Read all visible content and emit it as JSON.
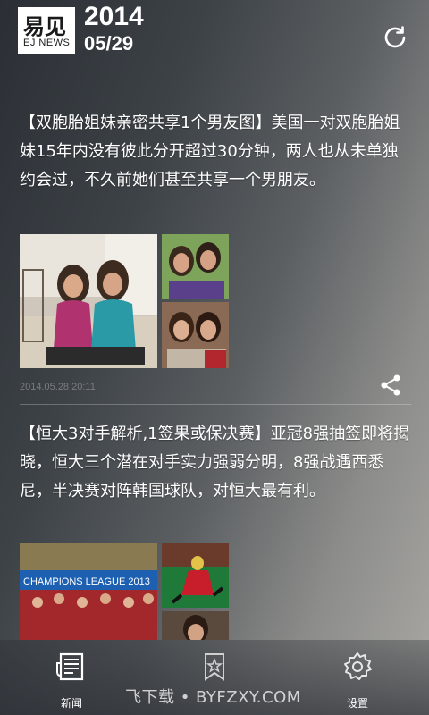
{
  "header": {
    "logo_cn": "易见",
    "logo_en": "EJ NEWS",
    "year": "2014",
    "month_day": "05/29"
  },
  "articles": [
    {
      "headline": "【双胞胎姐妹亲密共享1个男友图】美国一对双胞胎姐妹15年内没有彼此分开超过30分钟，两人也从未单独约会过，不久前她们甚至共享一个男朋友。",
      "timestamp": "2014.05.28 20:11"
    },
    {
      "headline": "【恒大3对手解析,1签果或保决赛】亚冠8强抽签即将揭晓，恒大三个潜在对手实力强弱分明，8强战遇西悉尼，半决赛对阵韩国球队，对恒大最有利。",
      "photo_banner": "CHAMPIONS LEAGUE 2013"
    }
  ],
  "tabbar": {
    "items": [
      {
        "label": "新闻",
        "icon": "newspaper-icon",
        "active": true
      },
      {
        "label": "",
        "icon": "bookmark-star-icon",
        "active": false
      },
      {
        "label": "设置",
        "icon": "gear-icon",
        "active": false
      }
    ]
  },
  "watermark": "飞下载 • BYFZXY.COM",
  "colors": {
    "accent": "#ffffff",
    "timestamp": "#7a7d80"
  }
}
